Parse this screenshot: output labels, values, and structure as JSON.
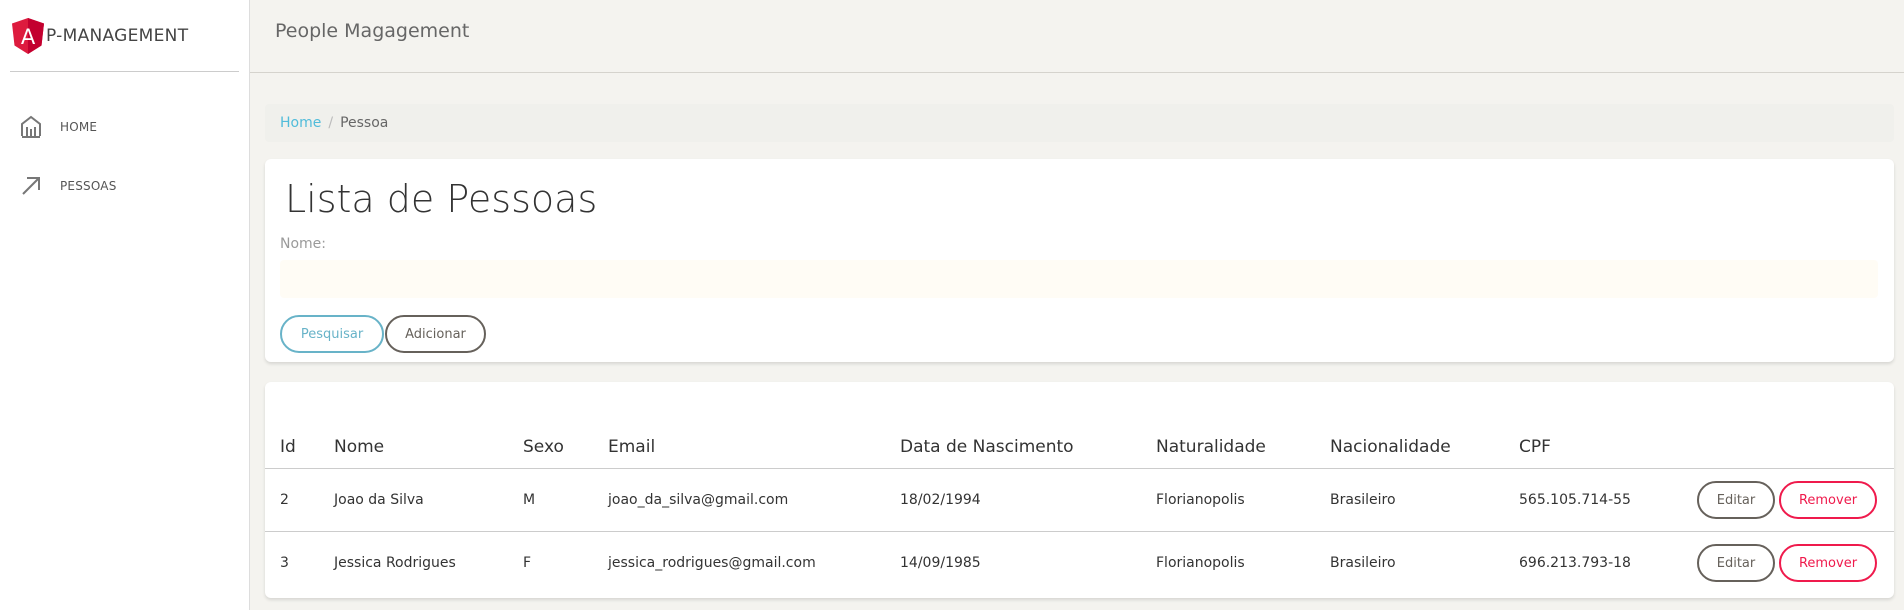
{
  "app": {
    "logo_letter": "A",
    "brand": "P-MANAGEMENT",
    "logo_color": "#dd1b3e"
  },
  "sidebar": {
    "items": [
      {
        "label": "HOME",
        "icon": "bank-icon"
      },
      {
        "label": "PESSOAS",
        "icon": "arrow-up-right-icon"
      }
    ]
  },
  "header": {
    "title": "People Magagement"
  },
  "breadcrumb": {
    "home": "Home",
    "separator": "/",
    "current": "Pessoa"
  },
  "search_card": {
    "title": "Lista de Pessoas",
    "name_label": "Nome:",
    "name_value": "",
    "search_button": "Pesquisar",
    "add_button": "Adicionar"
  },
  "table": {
    "columns": [
      "Id",
      "Nome",
      "Sexo",
      "Email",
      "Data de Nascimento",
      "Naturalidade",
      "Nacionalidade",
      "CPF"
    ],
    "rows": [
      {
        "id": "2",
        "nome": "Joao da Silva",
        "sexo": "M",
        "email": "joao_da_silva@gmail.com",
        "nascimento": "18/02/1994",
        "naturalidade": "Florianopolis",
        "nacionalidade": "Brasileiro",
        "cpf": "565.105.714-55"
      },
      {
        "id": "3",
        "nome": "Jessica Rodrigues",
        "sexo": "F",
        "email": "jessica_rodrigues@gmail.com",
        "nascimento": "14/09/1985",
        "naturalidade": "Florianopolis",
        "nacionalidade": "Brasileiro",
        "cpf": "696.213.793-18"
      }
    ],
    "edit_label": "Editar",
    "remove_label": "Remover"
  },
  "colors": {
    "info": "#68b3c8",
    "danger": "#ef1a4c",
    "link": "#51bcda",
    "dark": "#66615b"
  }
}
